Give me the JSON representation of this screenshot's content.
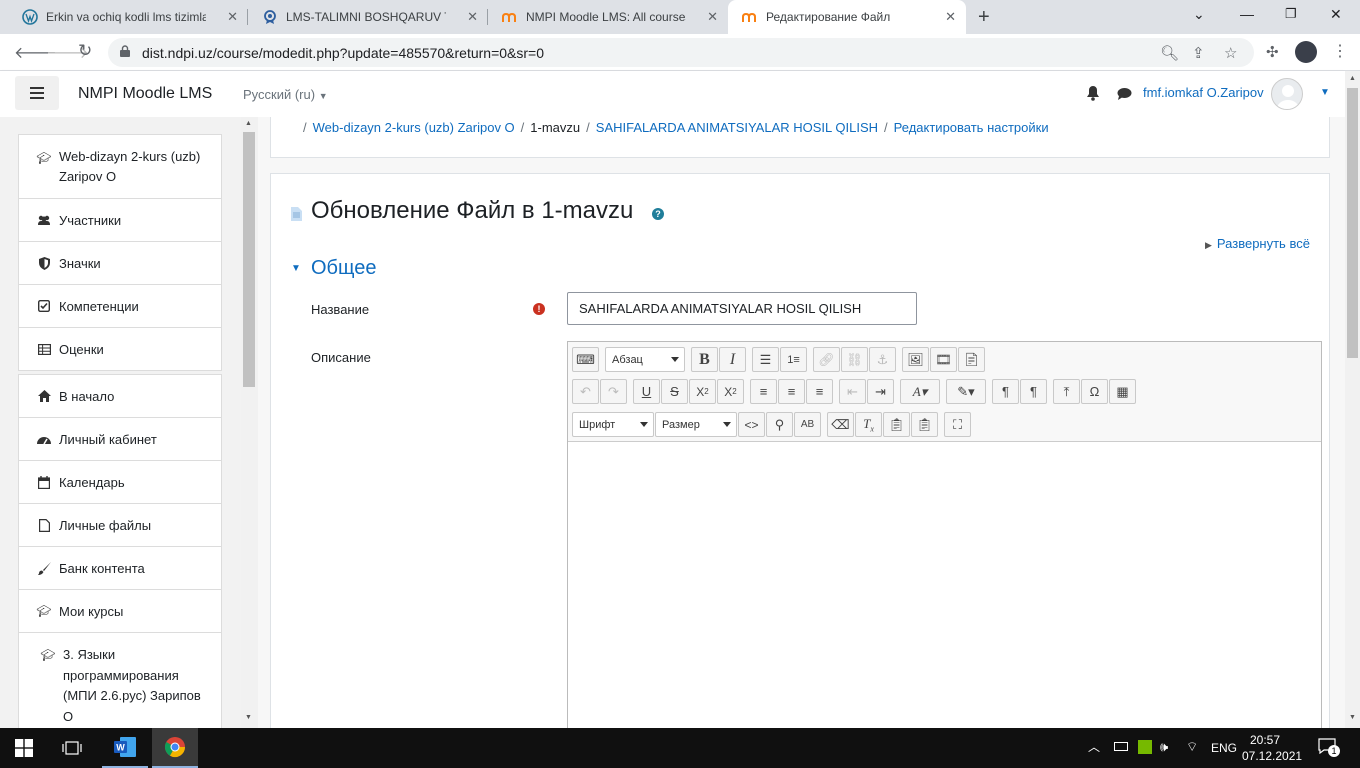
{
  "browser": {
    "tabs": [
      {
        "title": "Erkin va ochiq kodli lms tizimlar t",
        "icon": "wordpress-icon"
      },
      {
        "title": "LMS-TALIMNI BOSHQARUV TIZIM",
        "icon": "lms-icon"
      },
      {
        "title": "NMPI Moodle LMS: All courses",
        "icon": "moodle-icon"
      },
      {
        "title": "Редактирование Файл",
        "icon": "moodle-icon"
      }
    ],
    "url": "dist.ndpi.uz/course/modedit.php?update=485570&return=0&sr=0"
  },
  "header": {
    "site_name": "NMPI Moodle LMS",
    "language": "Русский (ru)",
    "user_name": "fmf.iomkaf O.Zaripov"
  },
  "sidebar": {
    "course_items": [
      {
        "label": "Web-dizayn 2-kurs (uzb) Zaripov O",
        "icon": "graduation-cap-icon"
      },
      {
        "label": "Участники",
        "icon": "users-icon"
      },
      {
        "label": "Значки",
        "icon": "shield-icon"
      },
      {
        "label": "Компетенции",
        "icon": "checkbox-icon"
      },
      {
        "label": "Оценки",
        "icon": "table-icon"
      }
    ],
    "nav_items": [
      {
        "label": "В начало",
        "icon": "home-icon"
      },
      {
        "label": "Личный кабинет",
        "icon": "dashboard-icon"
      },
      {
        "label": "Календарь",
        "icon": "calendar-icon"
      },
      {
        "label": "Личные файлы",
        "icon": "file-icon"
      },
      {
        "label": "Банк контента",
        "icon": "brush-icon"
      },
      {
        "label": "Мои курсы",
        "icon": "graduation-cap-icon"
      },
      {
        "label": "3. Языки программирования (МПИ 2.6.рус) Зарипов О",
        "icon": "graduation-cap-icon"
      }
    ]
  },
  "breadcrumb": [
    {
      "label": "Web-dizayn 2-kurs (uzb) Zaripov O",
      "link": true
    },
    {
      "label": "1-mavzu",
      "link": false
    },
    {
      "label": "SAHIFALARDA ANIMATSIYALAR HOSIL QILISH",
      "link": true
    },
    {
      "label": "Редактировать настройки",
      "link": true
    }
  ],
  "form": {
    "title": "Обновление Файл в 1-mavzu",
    "expand_all": "Развернуть всё",
    "section": "Общее",
    "name_label": "Название",
    "name_value": "SAHIFALARDA ANIMATSIYALAR HOSIL QILISH",
    "desc_label": "Описание",
    "editor": {
      "paragraph_select": "Абзац",
      "font_select": "Шрифт",
      "size_select": "Размер"
    }
  },
  "taskbar": {
    "language": "ENG",
    "time": "20:57",
    "date": "07.12.2021",
    "notifications": "1"
  },
  "colors": {
    "accent": "#0f6cbf",
    "tab_bar": "#dee1e6",
    "taskbar": "#101010",
    "required": "#ca3120"
  }
}
